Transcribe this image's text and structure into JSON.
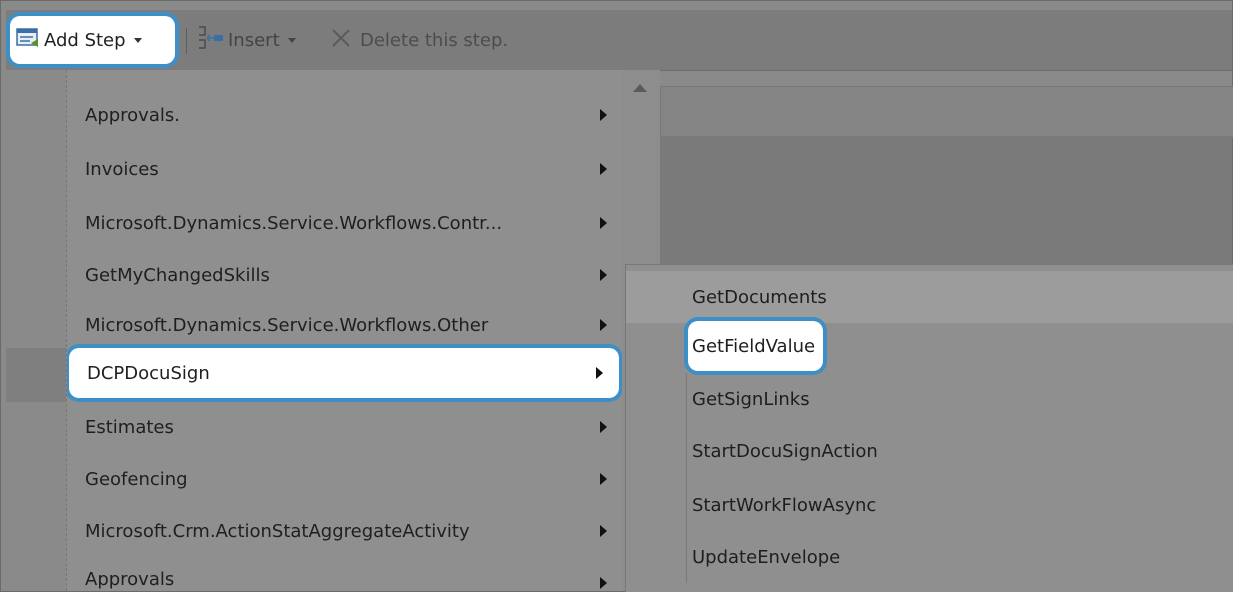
{
  "toolbar": {
    "add_step_label": "Add Step",
    "insert_label": "Insert",
    "delete_label": "Delete this step."
  },
  "menu": {
    "items": [
      {
        "label": "Approvals."
      },
      {
        "label": "Invoices"
      },
      {
        "label": "Microsoft.Dynamics.Service.Workflows.Contr..."
      },
      {
        "label": "GetMyChangedSkills"
      },
      {
        "label": "Microsoft.Dynamics.Service.Workflows.Other"
      },
      {
        "label": "DCPDocuSign"
      },
      {
        "label": "Estimates"
      },
      {
        "label": "Geofencing"
      },
      {
        "label": "Microsoft.Crm.ActionStatAggregateActivity"
      },
      {
        "label": "Approvals"
      }
    ]
  },
  "submenu": {
    "items": [
      {
        "label": "GetDocuments"
      },
      {
        "label": "GetFieldValue"
      },
      {
        "label": "GetSignLinks"
      },
      {
        "label": "StartDocuSignAction"
      },
      {
        "label": "StartWorkFlowAsync"
      },
      {
        "label": "UpdateEnvelope"
      }
    ]
  },
  "colors": {
    "highlight_border": "#3d8fc6",
    "menu_background": "#8f8f8f",
    "selected_background": "#ffffff"
  }
}
